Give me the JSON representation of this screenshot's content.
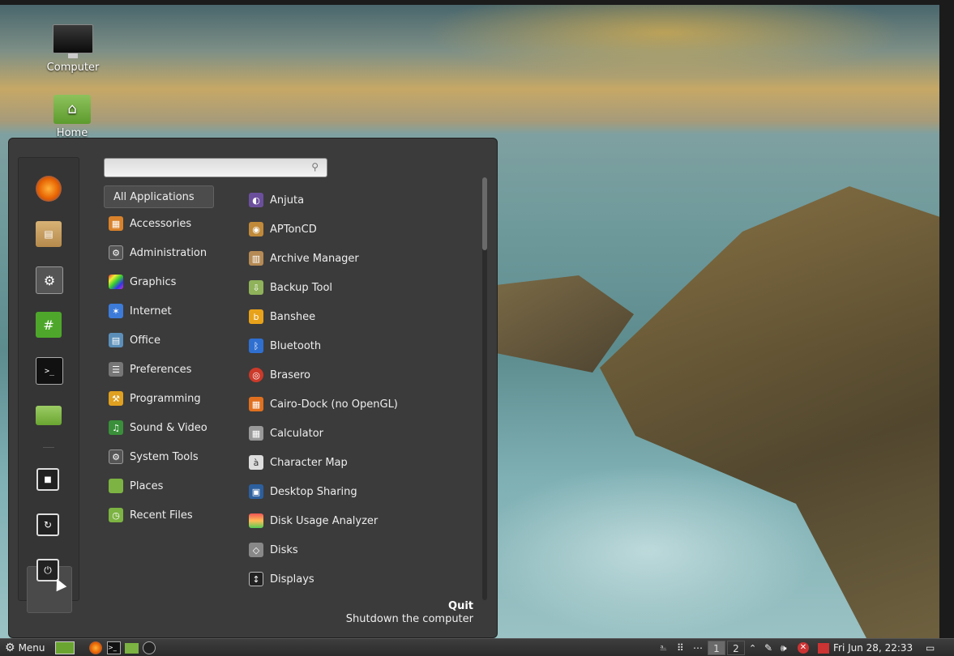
{
  "desktop": {
    "icons": [
      {
        "label": "Computer",
        "icon": "computer-icon"
      },
      {
        "label": "Home",
        "icon": "home-folder-icon"
      }
    ]
  },
  "menu": {
    "search": {
      "value": "",
      "placeholder": ""
    },
    "favorites": [
      {
        "name": "firefox",
        "icon": "firefox-icon",
        "color": "#e66000"
      },
      {
        "name": "software-manager",
        "icon": "package-icon",
        "color": "#c59a52"
      },
      {
        "name": "system-settings",
        "icon": "gear-icon",
        "color": "#555555"
      },
      {
        "name": "hexchat",
        "icon": "hash-icon",
        "color": "#4ea72a",
        "glyph": "#"
      },
      {
        "name": "terminal",
        "icon": "terminal-icon",
        "color": "#111111",
        "glyph": ">_"
      },
      {
        "name": "files",
        "icon": "folder-icon",
        "color": "#7cb342"
      }
    ],
    "session": [
      {
        "name": "lock-screen",
        "icon": "lock-icon",
        "glyph": "🔒"
      },
      {
        "name": "logout",
        "icon": "logout-icon",
        "glyph": "G"
      },
      {
        "name": "shutdown",
        "icon": "power-icon",
        "glyph": "⏻"
      }
    ],
    "categories": [
      {
        "label": "All Applications",
        "icon": "",
        "color": ""
      },
      {
        "label": "Accessories",
        "icon": "calculator-icon",
        "color": "#d9822b"
      },
      {
        "label": "Administration",
        "icon": "admin-gear-icon",
        "color": "#555555"
      },
      {
        "label": "Graphics",
        "icon": "graphics-icon",
        "color": "#c03ac0"
      },
      {
        "label": "Internet",
        "icon": "internet-icon",
        "color": "#3d7bd9"
      },
      {
        "label": "Office",
        "icon": "office-icon",
        "color": "#5b8fb9"
      },
      {
        "label": "Preferences",
        "icon": "preferences-icon",
        "color": "#777777"
      },
      {
        "label": "Programming",
        "icon": "programming-icon",
        "color": "#e0a020"
      },
      {
        "label": "Sound & Video",
        "icon": "sound-video-icon",
        "color": "#3a8f3a"
      },
      {
        "label": "System Tools",
        "icon": "system-tools-icon",
        "color": "#555555"
      },
      {
        "label": "Places",
        "icon": "places-folder-icon",
        "color": "#7cb342"
      },
      {
        "label": "Recent Files",
        "icon": "recent-folder-icon",
        "color": "#7cb342"
      }
    ],
    "applications": [
      {
        "label": "Anjuta",
        "icon": "anjuta-icon",
        "color": "#6c4f9c"
      },
      {
        "label": "APTonCD",
        "icon": "aptoncd-icon",
        "color": "#c08a3a"
      },
      {
        "label": "Archive Manager",
        "icon": "archive-icon",
        "color": "#b58a55"
      },
      {
        "label": "Backup Tool",
        "icon": "backup-icon",
        "color": "#8fb25a"
      },
      {
        "label": "Banshee",
        "icon": "banshee-icon",
        "color": "#e8a21a"
      },
      {
        "label": "Bluetooth",
        "icon": "bluetooth-icon",
        "color": "#2f6fd0"
      },
      {
        "label": "Brasero",
        "icon": "brasero-icon",
        "color": "#cc3a2a"
      },
      {
        "label": "Cairo-Dock (no OpenGL)",
        "icon": "cairo-dock-icon",
        "color": "#e07020"
      },
      {
        "label": "Calculator",
        "icon": "calculator-app-icon",
        "color": "#999999"
      },
      {
        "label": "Character Map",
        "icon": "character-map-icon",
        "color": "#dddddd"
      },
      {
        "label": "Desktop Sharing",
        "icon": "desktop-sharing-icon",
        "color": "#2c5f9e"
      },
      {
        "label": "Disk Usage Analyzer",
        "icon": "disk-usage-icon",
        "color": "#d24a4a"
      },
      {
        "label": "Disks",
        "icon": "disks-icon",
        "color": "#888888"
      },
      {
        "label": "Displays",
        "icon": "displays-icon",
        "color": "#222222"
      }
    ],
    "quit": {
      "title": "Quit",
      "description": "Shutdown the computer"
    }
  },
  "taskbar": {
    "menu_label": "Menu",
    "workspaces": [
      "1",
      "2"
    ],
    "active_workspace": "1",
    "clock": "Fri Jun 28, 22:33"
  }
}
